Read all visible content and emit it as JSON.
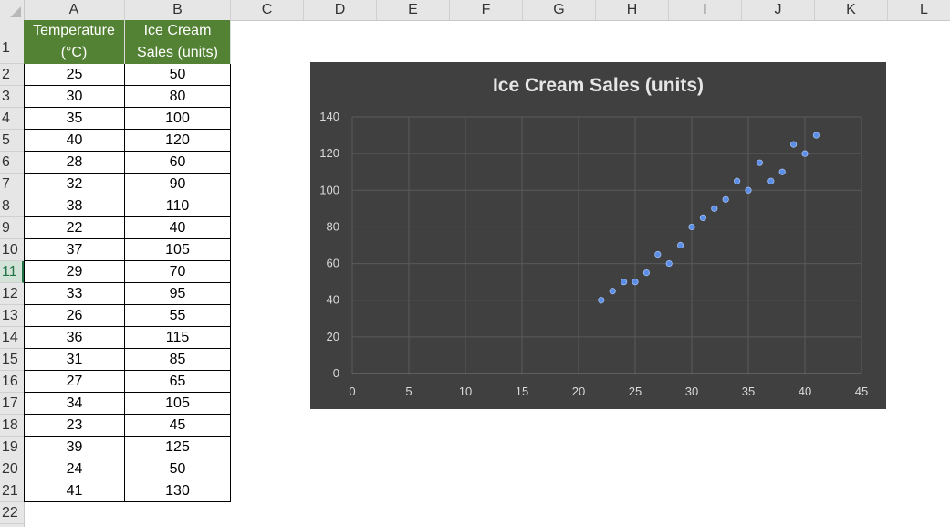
{
  "columns": [
    "A",
    "B",
    "C",
    "D",
    "E",
    "F",
    "G",
    "H",
    "I",
    "J",
    "K",
    "L"
  ],
  "rows": [
    "1",
    "2",
    "3",
    "4",
    "5",
    "6",
    "7",
    "8",
    "9",
    "10",
    "11",
    "12",
    "13",
    "14",
    "15",
    "16",
    "17",
    "18",
    "19",
    "20",
    "21",
    "22"
  ],
  "selected_row": "11",
  "table": {
    "headers": [
      "Temperature\n(°C)",
      "Ice Cream\nSales (units)"
    ],
    "header_color": "#548235",
    "data": [
      [
        "25",
        "50"
      ],
      [
        "30",
        "80"
      ],
      [
        "35",
        "100"
      ],
      [
        "40",
        "120"
      ],
      [
        "28",
        "60"
      ],
      [
        "32",
        "90"
      ],
      [
        "38",
        "110"
      ],
      [
        "22",
        "40"
      ],
      [
        "37",
        "105"
      ],
      [
        "29",
        "70"
      ],
      [
        "33",
        "95"
      ],
      [
        "26",
        "55"
      ],
      [
        "36",
        "115"
      ],
      [
        "31",
        "85"
      ],
      [
        "27",
        "65"
      ],
      [
        "34",
        "105"
      ],
      [
        "23",
        "45"
      ],
      [
        "39",
        "125"
      ],
      [
        "24",
        "50"
      ],
      [
        "41",
        "130"
      ]
    ]
  },
  "chart_data": {
    "type": "scatter",
    "title": "Ice Cream Sales (units)",
    "xlim": [
      0,
      45
    ],
    "ylim": [
      0,
      140
    ],
    "x_ticks": [
      "0",
      "5",
      "10",
      "15",
      "20",
      "25",
      "30",
      "35",
      "40",
      "45"
    ],
    "y_ticks": [
      "0",
      "20",
      "40",
      "60",
      "80",
      "100",
      "120",
      "140"
    ],
    "grid": true,
    "background": "#404040",
    "marker_color": "#5b8ee6",
    "points": [
      {
        "x": 25,
        "y": 50
      },
      {
        "x": 30,
        "y": 80
      },
      {
        "x": 35,
        "y": 100
      },
      {
        "x": 40,
        "y": 120
      },
      {
        "x": 28,
        "y": 60
      },
      {
        "x": 32,
        "y": 90
      },
      {
        "x": 38,
        "y": 110
      },
      {
        "x": 22,
        "y": 40
      },
      {
        "x": 37,
        "y": 105
      },
      {
        "x": 29,
        "y": 70
      },
      {
        "x": 33,
        "y": 95
      },
      {
        "x": 26,
        "y": 55
      },
      {
        "x": 36,
        "y": 115
      },
      {
        "x": 31,
        "y": 85
      },
      {
        "x": 27,
        "y": 65
      },
      {
        "x": 34,
        "y": 105
      },
      {
        "x": 23,
        "y": 45
      },
      {
        "x": 39,
        "y": 125
      },
      {
        "x": 24,
        "y": 50
      },
      {
        "x": 41,
        "y": 130
      }
    ]
  }
}
